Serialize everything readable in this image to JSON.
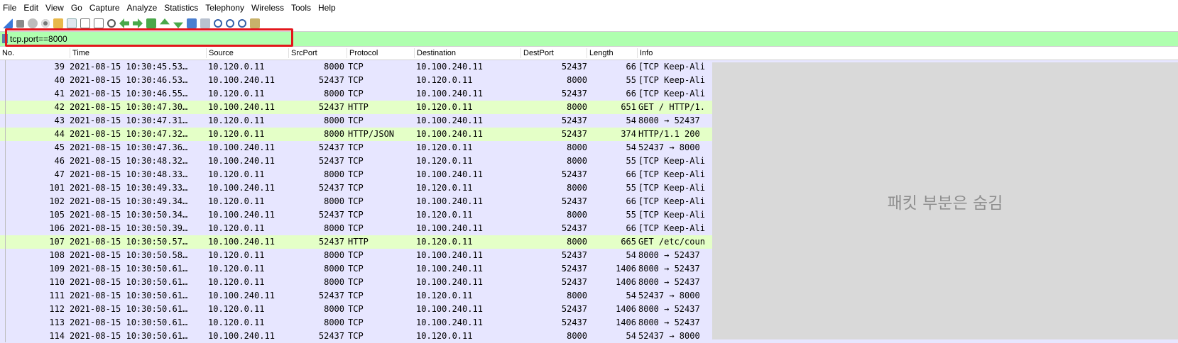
{
  "menu": [
    {
      "label": "File"
    },
    {
      "label": "Edit"
    },
    {
      "label": "View"
    },
    {
      "label": "Go"
    },
    {
      "label": "Capture"
    },
    {
      "label": "Analyze"
    },
    {
      "label": "Statistics"
    },
    {
      "label": "Telephony"
    },
    {
      "label": "Wireless"
    },
    {
      "label": "Tools"
    },
    {
      "label": "Help"
    }
  ],
  "toolbar_icons": [
    "shark-fin-icon",
    "stop-icon",
    "restart-icon",
    "capture-options-icon",
    "open-file-icon",
    "save-file-icon",
    "close-file-icon",
    "reload-icon",
    "find-packet-icon",
    "go-back-icon",
    "go-forward-icon",
    "go-to-packet-icon",
    "go-first-icon",
    "go-last-icon",
    "autoscroll-icon",
    "colorize-icon",
    "zoom-in-icon",
    "zoom-out-icon",
    "zoom-normal-icon",
    "resize-columns-icon"
  ],
  "filter": {
    "value": "tcp.port==8000",
    "background": "#afffaf"
  },
  "columns": [
    "No.",
    "Time",
    "Source",
    "SrcPort",
    "Protocol",
    "Destination",
    "DestPort",
    "Length",
    "Info"
  ],
  "rows": [
    {
      "no": "39",
      "time": "2021-08-15 10:30:45.53…",
      "src": "10.120.0.11",
      "sport": "8000",
      "proto": "TCP",
      "dst": "10.100.240.11",
      "dport": "52437",
      "len": "66",
      "info": "[TCP Keep-Ali",
      "color": "tcp"
    },
    {
      "no": "40",
      "time": "2021-08-15 10:30:46.53…",
      "src": "10.100.240.11",
      "sport": "52437",
      "proto": "TCP",
      "dst": "10.120.0.11",
      "dport": "8000",
      "len": "55",
      "info": "[TCP Keep-Ali",
      "color": "tcp"
    },
    {
      "no": "41",
      "time": "2021-08-15 10:30:46.55…",
      "src": "10.120.0.11",
      "sport": "8000",
      "proto": "TCP",
      "dst": "10.100.240.11",
      "dport": "52437",
      "len": "66",
      "info": "[TCP Keep-Ali",
      "color": "tcp"
    },
    {
      "no": "42",
      "time": "2021-08-15 10:30:47.30…",
      "src": "10.100.240.11",
      "sport": "52437",
      "proto": "HTTP",
      "dst": "10.120.0.11",
      "dport": "8000",
      "len": "651",
      "info": "GET / HTTP/1.",
      "color": "http"
    },
    {
      "no": "43",
      "time": "2021-08-15 10:30:47.31…",
      "src": "10.120.0.11",
      "sport": "8000",
      "proto": "TCP",
      "dst": "10.100.240.11",
      "dport": "52437",
      "len": "54",
      "info": "8000 → 52437",
      "color": "tcp"
    },
    {
      "no": "44",
      "time": "2021-08-15 10:30:47.32…",
      "src": "10.120.0.11",
      "sport": "8000",
      "proto": "HTTP/JSON",
      "dst": "10.100.240.11",
      "dport": "52437",
      "len": "374",
      "info": "HTTP/1.1 200",
      "color": "http"
    },
    {
      "no": "45",
      "time": "2021-08-15 10:30:47.36…",
      "src": "10.100.240.11",
      "sport": "52437",
      "proto": "TCP",
      "dst": "10.120.0.11",
      "dport": "8000",
      "len": "54",
      "info": "52437 → 8000",
      "color": "tcp"
    },
    {
      "no": "46",
      "time": "2021-08-15 10:30:48.32…",
      "src": "10.100.240.11",
      "sport": "52437",
      "proto": "TCP",
      "dst": "10.120.0.11",
      "dport": "8000",
      "len": "55",
      "info": "[TCP Keep-Ali",
      "color": "tcp"
    },
    {
      "no": "47",
      "time": "2021-08-15 10:30:48.33…",
      "src": "10.120.0.11",
      "sport": "8000",
      "proto": "TCP",
      "dst": "10.100.240.11",
      "dport": "52437",
      "len": "66",
      "info": "[TCP Keep-Ali",
      "color": "tcp"
    },
    {
      "no": "101",
      "time": "2021-08-15 10:30:49.33…",
      "src": "10.100.240.11",
      "sport": "52437",
      "proto": "TCP",
      "dst": "10.120.0.11",
      "dport": "8000",
      "len": "55",
      "info": "[TCP Keep-Ali",
      "color": "tcp"
    },
    {
      "no": "102",
      "time": "2021-08-15 10:30:49.34…",
      "src": "10.120.0.11",
      "sport": "8000",
      "proto": "TCP",
      "dst": "10.100.240.11",
      "dport": "52437",
      "len": "66",
      "info": "[TCP Keep-Ali",
      "color": "tcp"
    },
    {
      "no": "105",
      "time": "2021-08-15 10:30:50.34…",
      "src": "10.100.240.11",
      "sport": "52437",
      "proto": "TCP",
      "dst": "10.120.0.11",
      "dport": "8000",
      "len": "55",
      "info": "[TCP Keep-Ali",
      "color": "tcp"
    },
    {
      "no": "106",
      "time": "2021-08-15 10:30:50.39…",
      "src": "10.120.0.11",
      "sport": "8000",
      "proto": "TCP",
      "dst": "10.100.240.11",
      "dport": "52437",
      "len": "66",
      "info": "[TCP Keep-Ali",
      "color": "tcp"
    },
    {
      "no": "107",
      "time": "2021-08-15 10:30:50.57…",
      "src": "10.100.240.11",
      "sport": "52437",
      "proto": "HTTP",
      "dst": "10.120.0.11",
      "dport": "8000",
      "len": "665",
      "info": "GET /etc/coun",
      "color": "http"
    },
    {
      "no": "108",
      "time": "2021-08-15 10:30:50.58…",
      "src": "10.120.0.11",
      "sport": "8000",
      "proto": "TCP",
      "dst": "10.100.240.11",
      "dport": "52437",
      "len": "54",
      "info": "8000 → 52437",
      "color": "tcp"
    },
    {
      "no": "109",
      "time": "2021-08-15 10:30:50.61…",
      "src": "10.120.0.11",
      "sport": "8000",
      "proto": "TCP",
      "dst": "10.100.240.11",
      "dport": "52437",
      "len": "1406",
      "info": "8000 → 52437",
      "color": "tcp"
    },
    {
      "no": "110",
      "time": "2021-08-15 10:30:50.61…",
      "src": "10.120.0.11",
      "sport": "8000",
      "proto": "TCP",
      "dst": "10.100.240.11",
      "dport": "52437",
      "len": "1406",
      "info": "8000 → 52437",
      "color": "tcp"
    },
    {
      "no": "111",
      "time": "2021-08-15 10:30:50.61…",
      "src": "10.100.240.11",
      "sport": "52437",
      "proto": "TCP",
      "dst": "10.120.0.11",
      "dport": "8000",
      "len": "54",
      "info": "52437 → 8000",
      "color": "tcp"
    },
    {
      "no": "112",
      "time": "2021-08-15 10:30:50.61…",
      "src": "10.120.0.11",
      "sport": "8000",
      "proto": "TCP",
      "dst": "10.100.240.11",
      "dport": "52437",
      "len": "1406",
      "info": "8000 → 52437",
      "color": "tcp"
    },
    {
      "no": "113",
      "time": "2021-08-15 10:30:50.61…",
      "src": "10.120.0.11",
      "sport": "8000",
      "proto": "TCP",
      "dst": "10.100.240.11",
      "dport": "52437",
      "len": "1406",
      "info": "8000 → 52437",
      "color": "tcp"
    },
    {
      "no": "114",
      "time": "2021-08-15 10:30:50.61…",
      "src": "10.100.240.11",
      "sport": "52437",
      "proto": "TCP",
      "dst": "10.120.0.11",
      "dport": "8000",
      "len": "54",
      "info": "52437 → 8000",
      "color": "tcp"
    }
  ],
  "row_colors": {
    "tcp": "#e7e6ff",
    "http": "#e4ffc7"
  },
  "highlight_color": "#e3161b",
  "mask_text": "패킷 부분은 숨김"
}
